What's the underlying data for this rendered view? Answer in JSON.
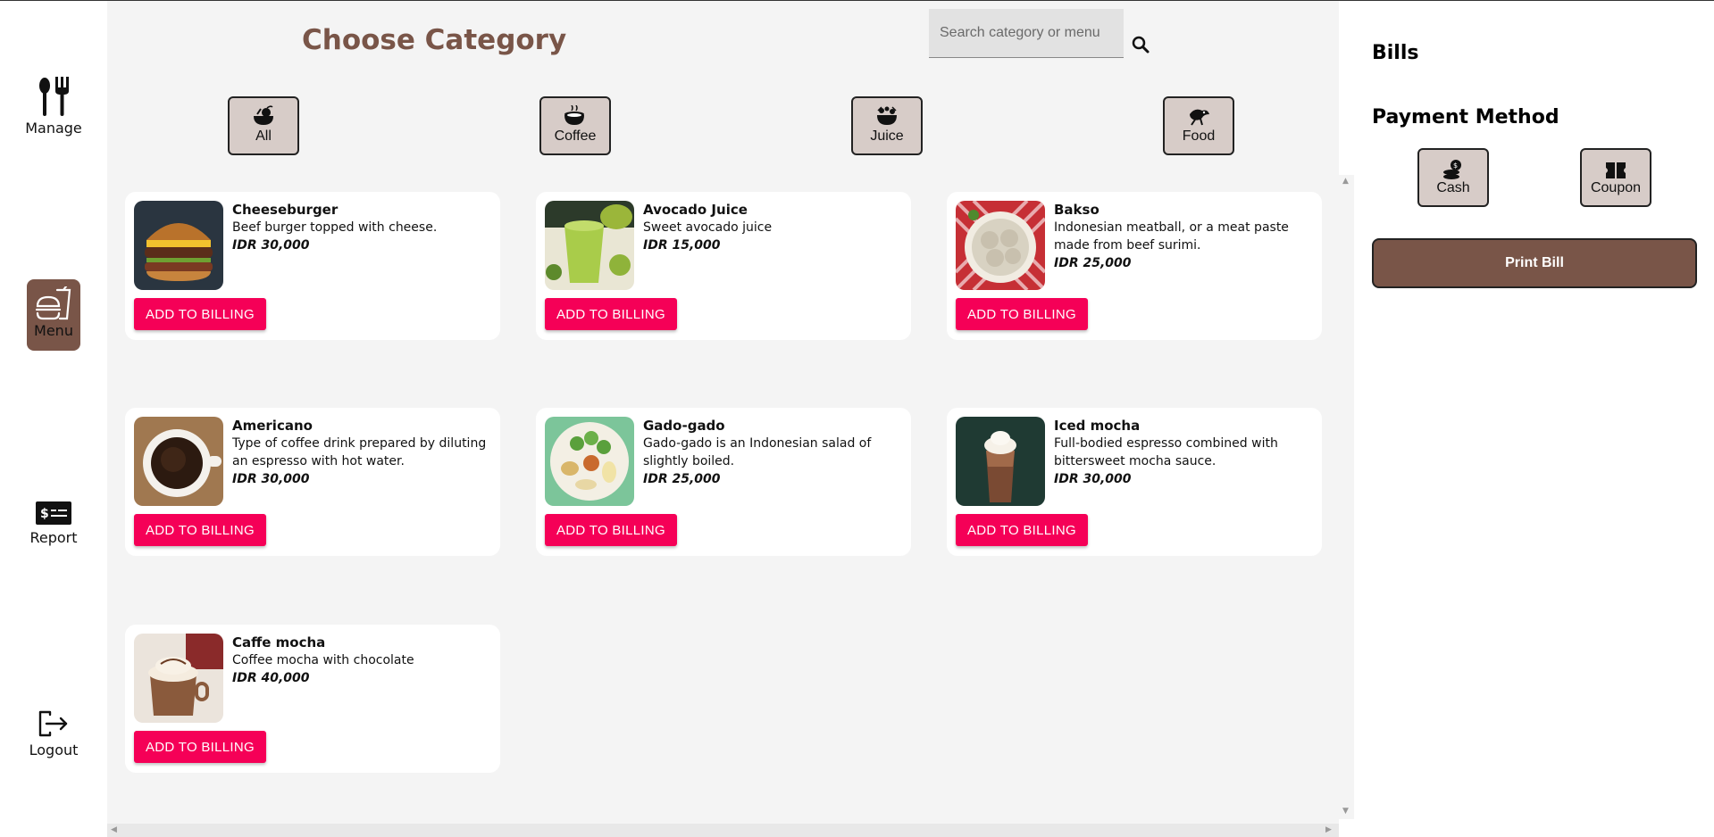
{
  "nav": {
    "manage": "Manage",
    "menu": "Menu",
    "report": "Report",
    "logout": "Logout"
  },
  "header": {
    "title": "Choose Category",
    "search_placeholder": "Search category or menu"
  },
  "categories": [
    {
      "label": "All",
      "icon": "food-bowl-icon"
    },
    {
      "label": "Coffee",
      "icon": "coffee-icon"
    },
    {
      "label": "Juice",
      "icon": "juice-icon"
    },
    {
      "label": "Food",
      "icon": "food-icon"
    }
  ],
  "add_label": "ADD TO BILLING",
  "menu_items": [
    {
      "name": "Cheeseburger",
      "desc": "Beef burger topped with cheese.",
      "price": "IDR 30,000"
    },
    {
      "name": "Avocado Juice",
      "desc": "Sweet avocado juice",
      "price": "IDR 15,000"
    },
    {
      "name": "Bakso",
      "desc": "Indonesian meatball, or a meat paste made from beef surimi.",
      "price": "IDR 25,000"
    },
    {
      "name": "Americano",
      "desc": "Type of coffee drink prepared by diluting an espresso with hot water.",
      "price": "IDR 30,000"
    },
    {
      "name": "Gado-gado",
      "desc": "Gado-gado is an Indonesian salad of slightly boiled.",
      "price": "IDR 25,000"
    },
    {
      "name": "Iced mocha",
      "desc": "Full-bodied espresso combined with bittersweet mocha sauce.",
      "price": "IDR 30,000"
    },
    {
      "name": "Caffe mocha",
      "desc": "Coffee mocha with chocolate",
      "price": "IDR 40,000"
    }
  ],
  "bills": {
    "title": "Bills",
    "payment_title": "Payment Method",
    "cash": "Cash",
    "coupon": "Coupon",
    "print": "Print Bill"
  },
  "colors": {
    "brand": "#795548",
    "category_bg": "#d7ccc8",
    "add_button": "#f50057"
  }
}
